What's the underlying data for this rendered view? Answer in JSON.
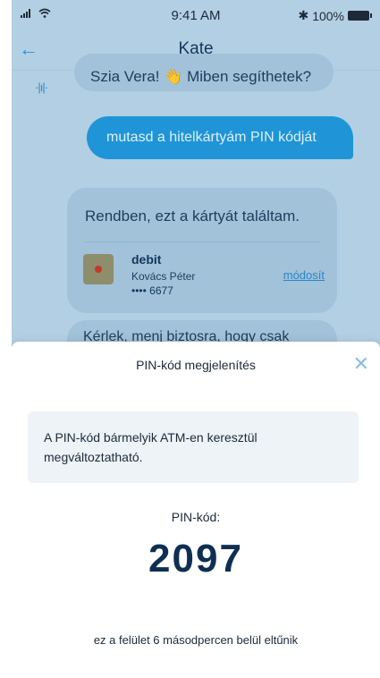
{
  "status_bar": {
    "time": "9:41 AM",
    "battery": "100%"
  },
  "header": {
    "title": "Kate"
  },
  "chat": {
    "bot_greeting": "Szia Vera! 👋 Miben segíthetek?",
    "user_message": "mutasd a hitelkártyám PIN kódját",
    "bot_reply": "Rendben, ezt a kártyát találtam.",
    "card": {
      "name": "debit",
      "holder": "Kovács Péter",
      "number": "•••• 6677",
      "edit_link": "módosít"
    },
    "bot_partial": "Kérlek, menj biztosra, hogy csak"
  },
  "sheet": {
    "title": "PIN-kód megjelenítés",
    "info": "A PIN-kód bármelyik ATM-en keresztül megváltoztatható.",
    "pin_label": "PIN-kód:",
    "pin_value": "2097",
    "footer": "ez a felület 6 másodpercen belül eltűnik"
  }
}
